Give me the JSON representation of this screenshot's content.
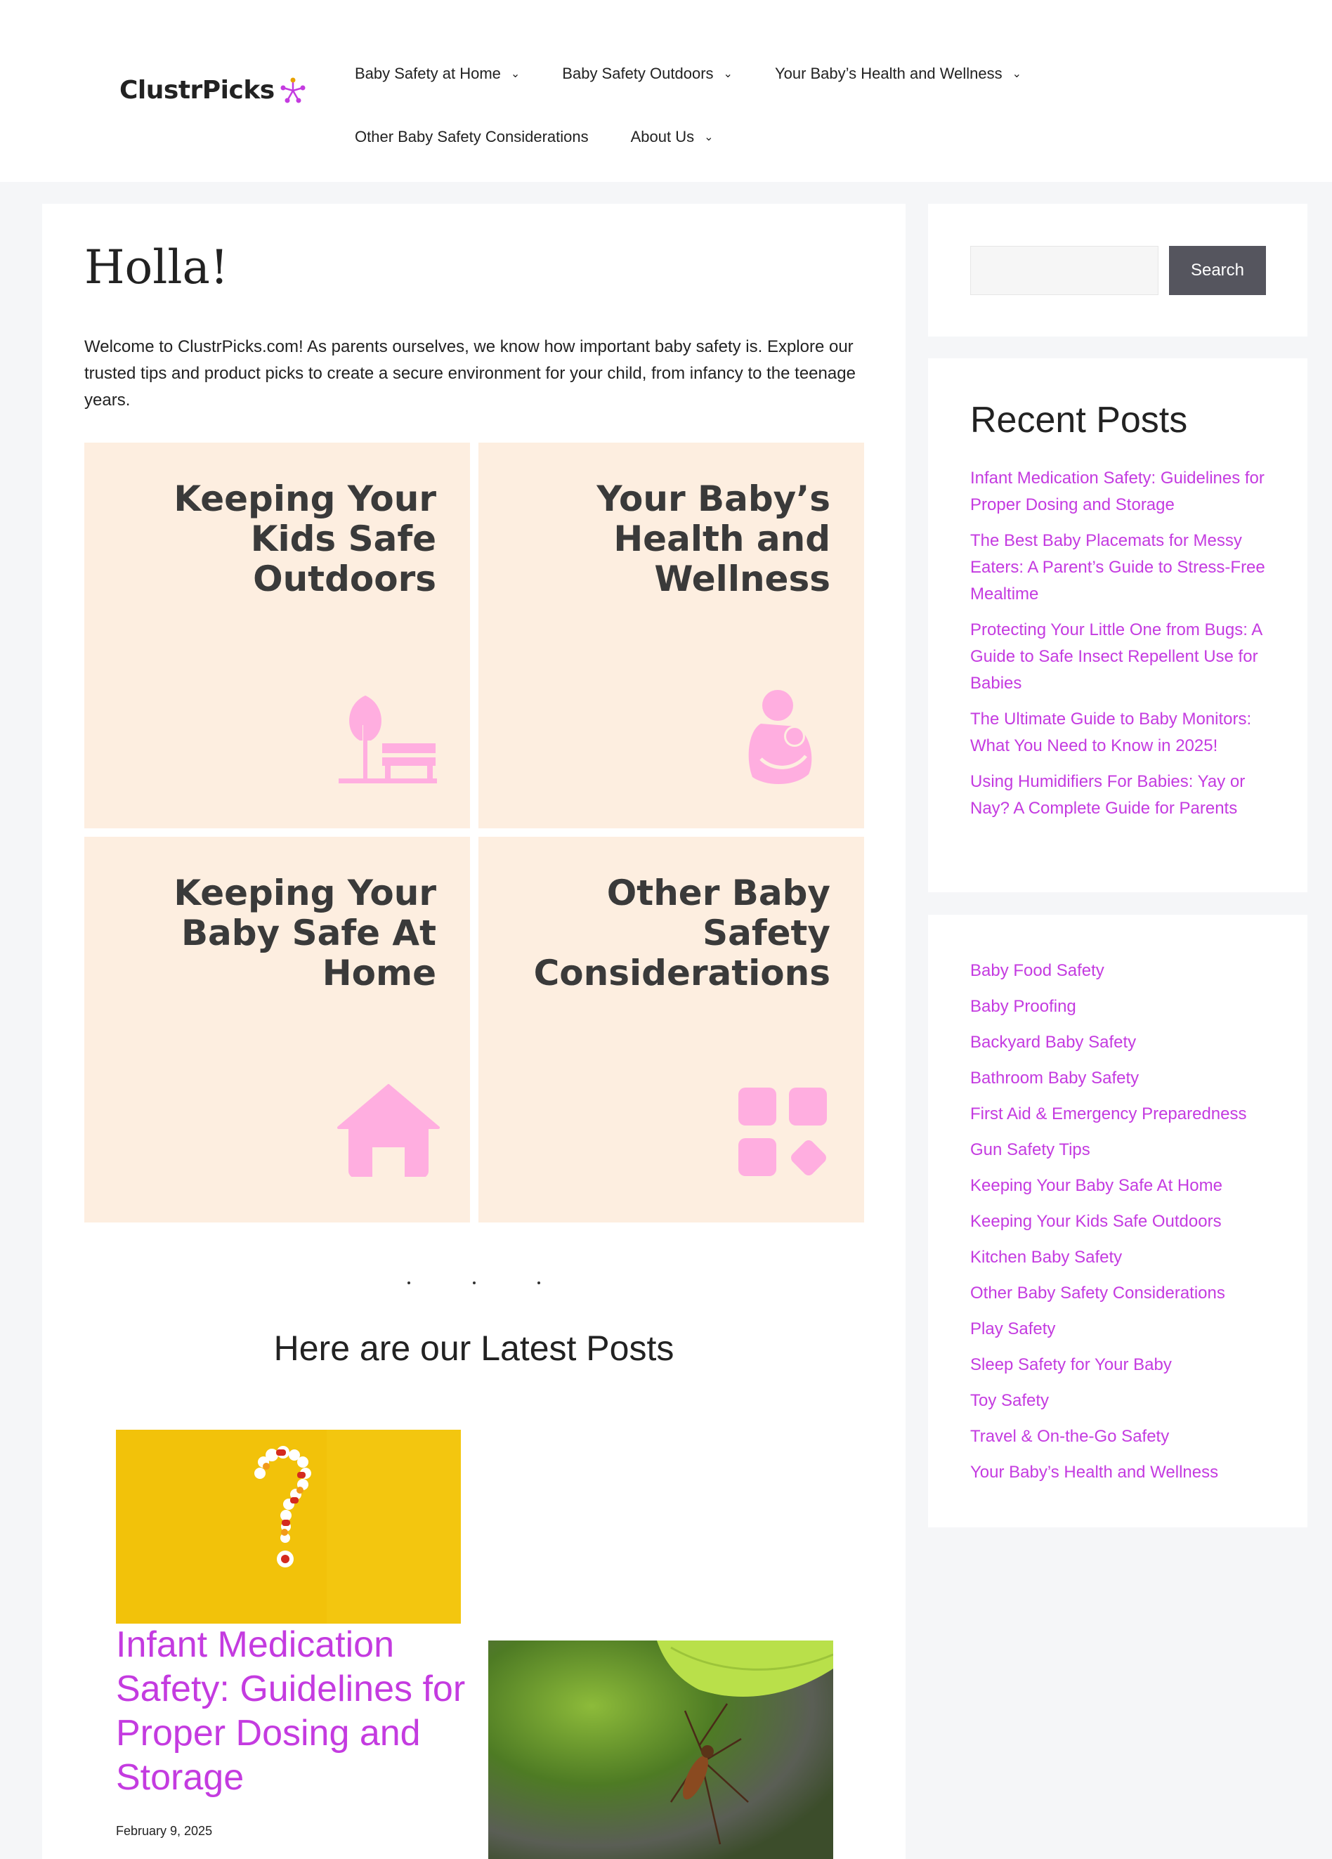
{
  "brand": {
    "name": "ClustrPicks"
  },
  "nav": {
    "row1": [
      {
        "label": "Baby Safety at Home"
      },
      {
        "label": "Baby Safety Outdoors"
      },
      {
        "label": "Your Baby’s Health and Wellness"
      }
    ],
    "row2": [
      {
        "label": "Other Baby Safety Considerations"
      },
      {
        "label": "About Us"
      }
    ]
  },
  "main": {
    "heading": "Holla!",
    "intro": "Welcome to ClustrPicks.com! As parents ourselves, we know how important baby safety is. Explore our trusted tips and product picks to create a secure environment for your child, from infancy to the teenage years.",
    "tiles": [
      {
        "title": "Keeping Your Kids Safe Outdoors",
        "icon": "park-bench-tree-icon"
      },
      {
        "title": "Your Baby’s Health and Wellness",
        "icon": "mother-baby-icon"
      },
      {
        "title": "Keeping Your Baby Safe At Home",
        "icon": "house-icon"
      },
      {
        "title": "Other Baby Safety Considerations",
        "icon": "apps-grid-icon"
      }
    ],
    "latest_heading": "Here are our Latest Posts",
    "posts": [
      {
        "title": "Infant Medication Safety: Guidelines for Proper Dosing and Storage",
        "date": "February 9, 2025",
        "image": "pills-question-mark"
      },
      {
        "image": "mosquito-on-leaf"
      }
    ]
  },
  "sidebar": {
    "search_button": "Search",
    "recent_heading": "Recent Posts",
    "recent_posts": [
      "Infant Medication Safety: Guidelines for Proper Dosing and Storage",
      "The Best Baby Placemats for Messy Eaters: A Parent’s Guide to Stress-Free Mealtime",
      "Protecting Your Little One from Bugs: A Guide to Safe Insect Repellent Use for Babies",
      "The Ultimate Guide to Baby Monitors: What You Need to Know in 2025!",
      "Using Humidifiers For Babies: Yay or Nay? A Complete Guide for Parents"
    ],
    "categories": [
      "Baby Food Safety",
      "Baby Proofing",
      "Backyard Baby Safety",
      "Bathroom Baby Safety",
      "First Aid & Emergency Preparedness",
      "Gun Safety Tips",
      "Keeping Your Baby Safe At Home",
      "Keeping Your Kids Safe Outdoors",
      "Kitchen Baby Safety",
      "Other Baby Safety Considerations",
      "Play Safety",
      "Sleep Safety for Your Baby",
      "Toy Safety",
      "Travel & On-the-Go Safety",
      "Your Baby’s Health and Wellness"
    ]
  },
  "colors": {
    "link": "#c43be0",
    "tile_bg": "#fdeee0",
    "icon": "#ffaee0",
    "button": "#55555e"
  }
}
